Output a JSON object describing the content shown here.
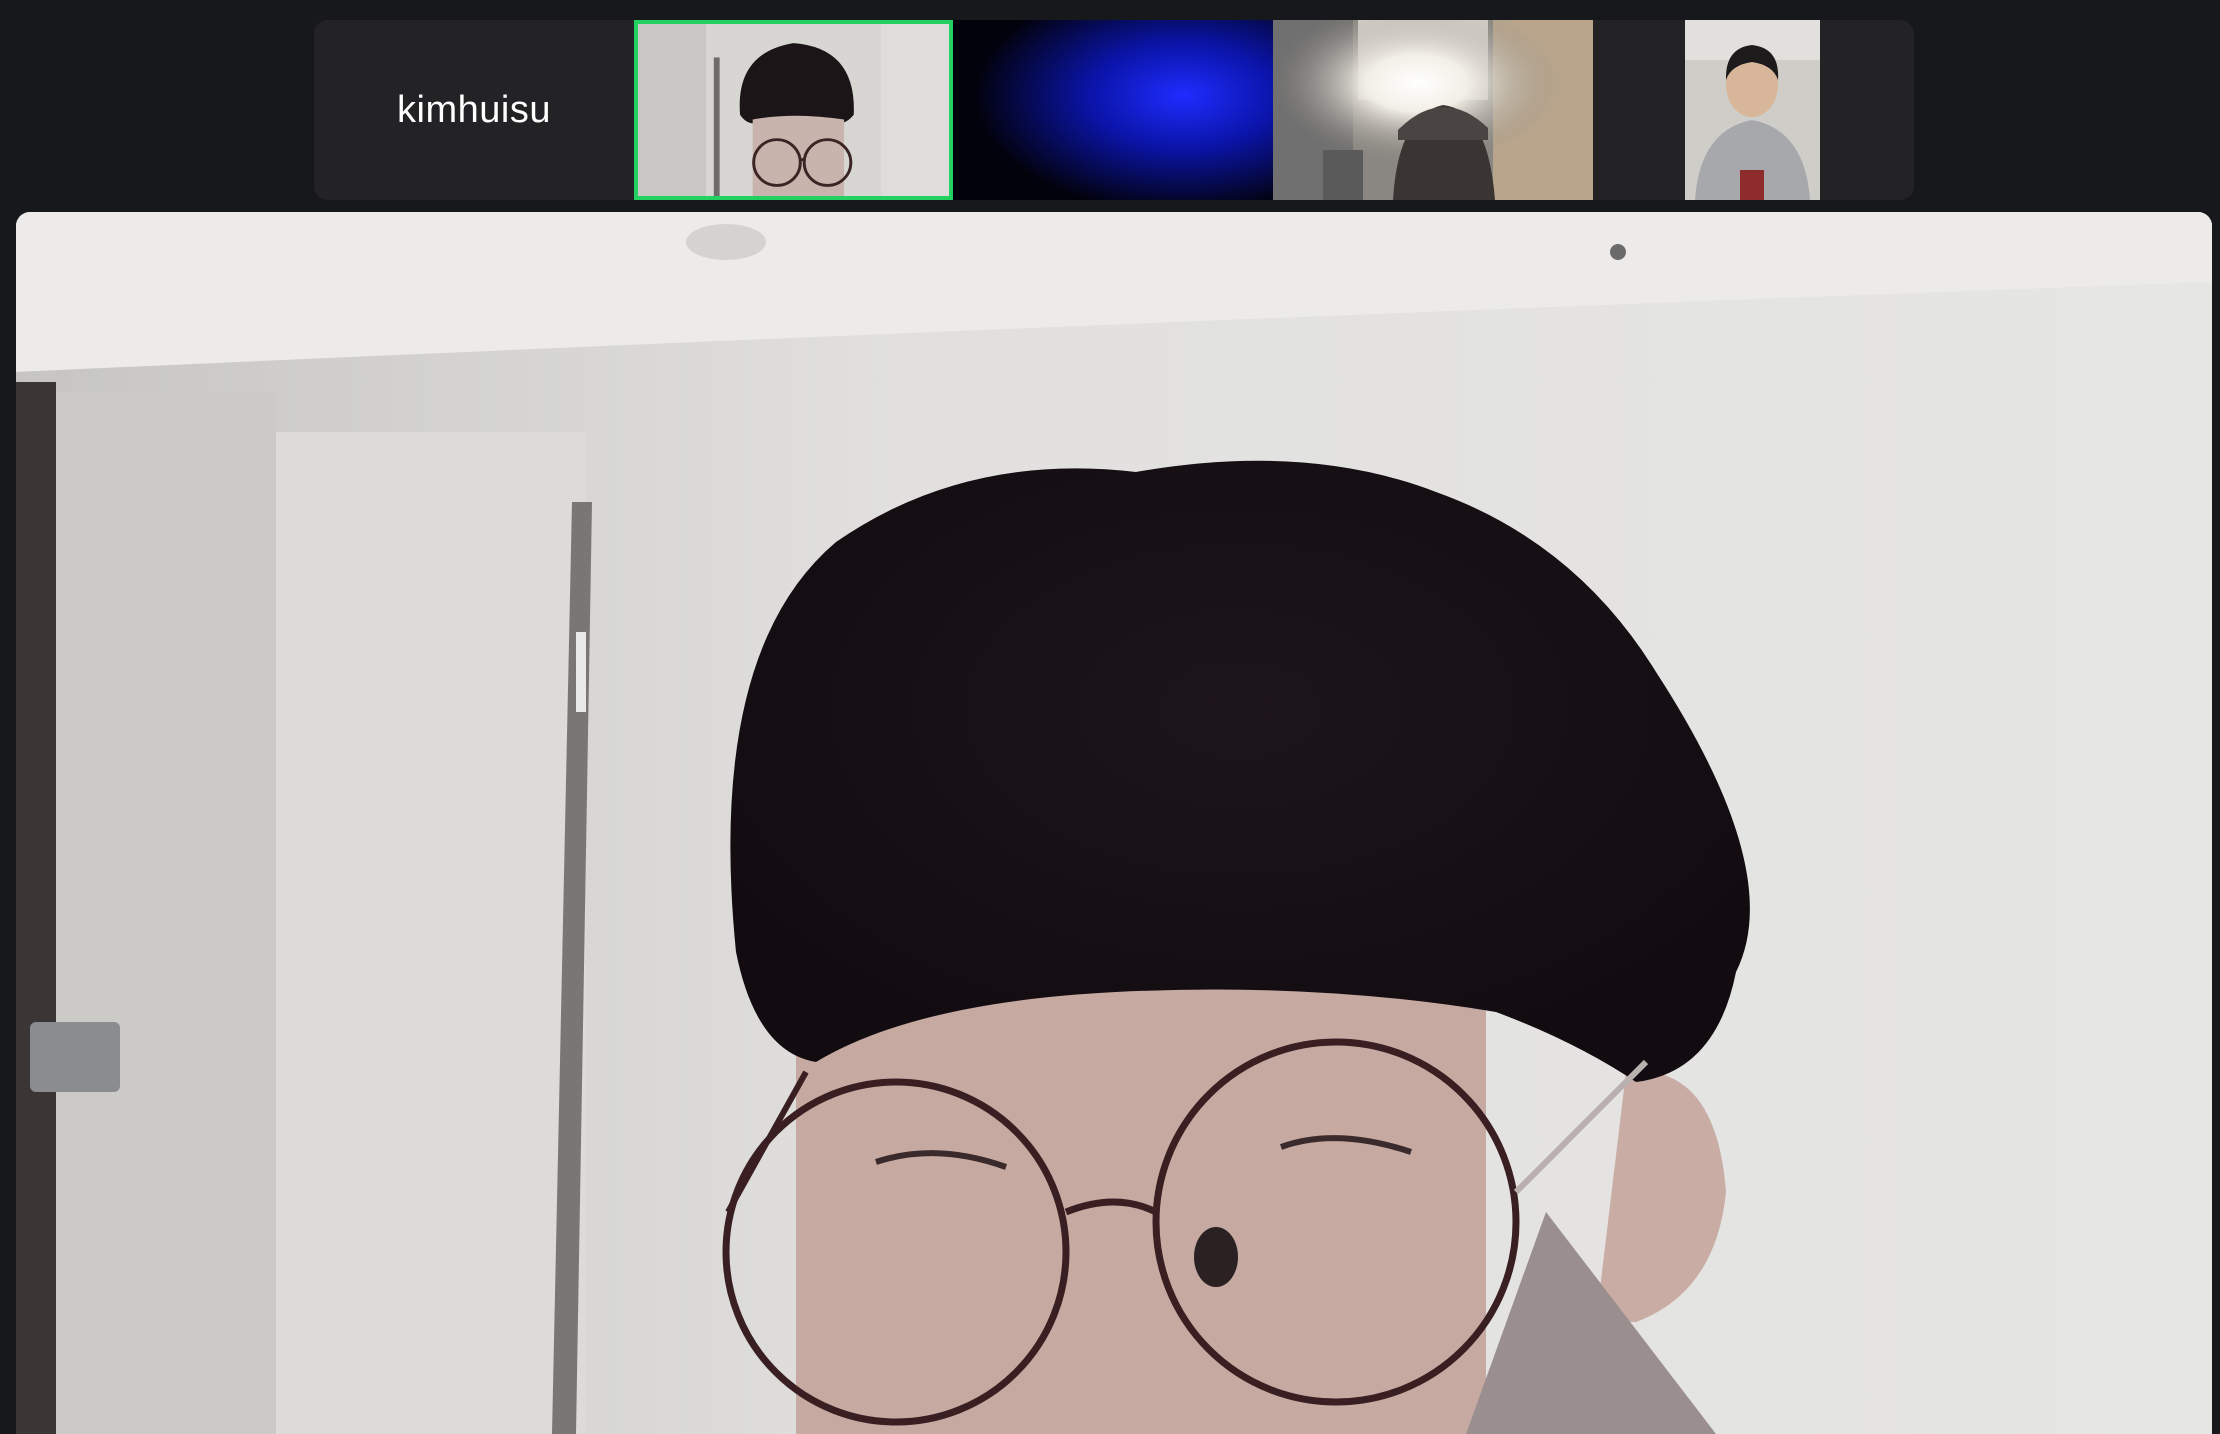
{
  "gallery": {
    "name_tile_label": "kimhuisu"
  },
  "colors": {
    "background": "#17181b",
    "strip": "#232325",
    "active_speaker_border": "#23d160"
  },
  "icons": [
    "speaker-video-icon"
  ]
}
